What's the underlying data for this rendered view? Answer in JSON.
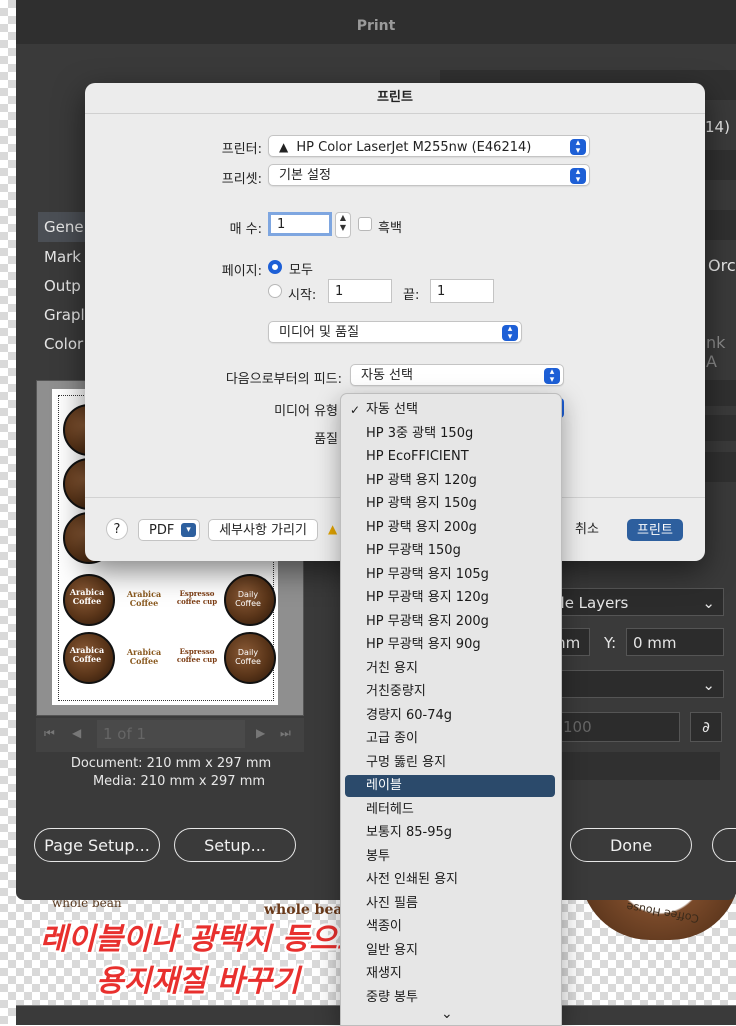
{
  "ai_window": {
    "title": "Print",
    "partial_right_texts": [
      "14)",
      "Orc",
      "nk A"
    ],
    "sidebar": [
      {
        "label": "Gene",
        "selected": true
      },
      {
        "label": "Mark",
        "selected": false
      },
      {
        "label": "Outp",
        "selected": false
      },
      {
        "label": "Grapl",
        "selected": false
      },
      {
        "label": "Color",
        "selected": false
      }
    ],
    "preview_nav": {
      "page_field": "1 of 1"
    },
    "document_size": "Document: 210 mm x 297 mm",
    "media_size": "Media: 210 mm x 297 mm",
    "layers_value": "ble Layers",
    "x_unit": "mm",
    "y_label": "Y:",
    "y_value": "0 mm",
    "scale_value": "100",
    "page_setup_button": "Page Setup...",
    "setup_button": "Setup...",
    "done_button": "Done"
  },
  "mac_dialog": {
    "title": "프린트",
    "printer_label": "프린터:",
    "printer_value": "HP Color LaserJet M255nw (E46214)",
    "preset_label": "프리셋:",
    "preset_value": "기본 설정",
    "copies_label": "매 수:",
    "copies_value": "1",
    "bw_label": "흑백",
    "pages_label": "페이지:",
    "pages_all": "모두",
    "pages_from_label": "시작:",
    "pages_from_value": "1",
    "pages_to_label": "끝:",
    "pages_to_value": "1",
    "section_popup": "미디어 및 품질",
    "feed_label": "다음으로부터의 피드:",
    "feed_value": "자동 선택",
    "media_type_label": "미디어 유형",
    "quality_label": "품질",
    "help_button": "?",
    "pdf_button": "PDF",
    "hide_details_button": "세부사항 가리기",
    "cancel_button": "취소",
    "print_button": "프린트"
  },
  "media_type_menu": {
    "items": [
      {
        "label": "자동 선택",
        "checked": true
      },
      {
        "label": "HP 3중 광택 150g"
      },
      {
        "label": "HP EcoFFICIENT"
      },
      {
        "label": "HP 광택 용지 120g"
      },
      {
        "label": "HP 광택 용지 150g"
      },
      {
        "label": "HP 광택 용지 200g"
      },
      {
        "label": "HP 무광택 150g"
      },
      {
        "label": "HP 무광택 용지 105g"
      },
      {
        "label": "HP 무광택 용지 120g"
      },
      {
        "label": "HP 무광택 용지 200g"
      },
      {
        "label": "HP 무광택 용지 90g"
      },
      {
        "label": "거친 용지"
      },
      {
        "label": "거친중량지"
      },
      {
        "label": "경량지 60-74g"
      },
      {
        "label": "고급 종이"
      },
      {
        "label": "구멍 뚫린 용지"
      },
      {
        "label": "레이블",
        "selected": true
      },
      {
        "label": "레터헤드"
      },
      {
        "label": "보통지 85-95g"
      },
      {
        "label": "봉투"
      },
      {
        "label": "사전 인쇄된 용지"
      },
      {
        "label": "사진 필름"
      },
      {
        "label": "색종이"
      },
      {
        "label": "일반 용지"
      },
      {
        "label": "재생지"
      },
      {
        "label": "중량 봉투"
      }
    ],
    "scroll_arrow": "⌄"
  },
  "overlay": {
    "line1": "레이블이나 광택지 등으로",
    "line2": "용지재질 바꾸기",
    "color": "#e8302e"
  },
  "background_art": {
    "whole_bean_1": "whole bean",
    "whole_bean_2": "whole bean",
    "coffee_house": "Coffee House"
  },
  "stickers": {
    "arabica": "Arabica Coffee",
    "espresso": "Espresso coffee cup",
    "daily": "Daily Coffee"
  }
}
